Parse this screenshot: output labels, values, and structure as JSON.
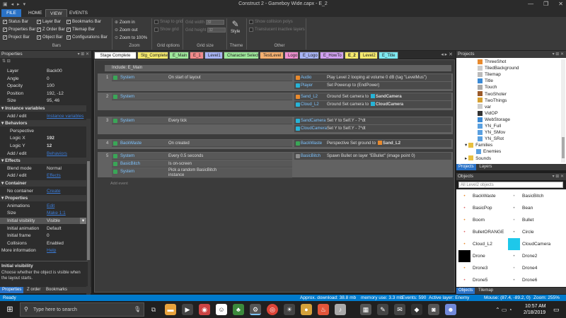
{
  "window": {
    "title": "Construct 2 - Gameboy Wide.capx - E_2",
    "quick_access": [
      "▣",
      "◂",
      "▸",
      "▾"
    ],
    "minimize": "—",
    "maximize": "❐",
    "close": "✕"
  },
  "ribbon": {
    "tabs": [
      "FILE",
      "HOME",
      "VIEW",
      "EVENTS"
    ],
    "bars": {
      "status": "Status Bar",
      "properties": "Properties Bar",
      "project": "Project Bar",
      "layer": "Layer Bar",
      "zorder": "Z Order Bar",
      "object": "Object Bar",
      "bookmarks": "Bookmarks Bar",
      "tilemap": "Tilemap Bar",
      "configurations": "Configurations Bar",
      "group": "Bars"
    },
    "zoom": {
      "in": "Zoom in",
      "out": "Zoom out",
      "reset": "Zoom to 100%",
      "group": "Zoom"
    },
    "grid_options": {
      "snap": "Snap to grid",
      "show": "Show grid",
      "group": "Grid options"
    },
    "grid_size": {
      "width_label": "Grid width",
      "width": "32",
      "height_label": "Grid height",
      "height": "32",
      "group": "Grid size"
    },
    "theme": {
      "style": "Style",
      "group": "Theme"
    },
    "other": {
      "collision": "Show collision polys",
      "translucent": "Translucent inactive layers",
      "group": "Other"
    }
  },
  "properties": {
    "title": "Properties",
    "rows": [
      {
        "k": "Layer",
        "v": "Back00",
        "t": "row"
      },
      {
        "k": "Angle",
        "v": "0",
        "t": "row"
      },
      {
        "k": "Opacity",
        "v": "100",
        "t": "row"
      },
      {
        "k": "Position",
        "v": "192, -12",
        "t": "row"
      },
      {
        "k": "Size",
        "v": "95, 46",
        "t": "row"
      },
      {
        "k": "Instance variables",
        "v": "",
        "t": "cat"
      },
      {
        "k": "Add / edit",
        "v": "Instance variables",
        "t": "link"
      },
      {
        "k": "Behaviors",
        "v": "",
        "t": "cat"
      },
      {
        "k": "Perspective",
        "v": "",
        "t": "sub"
      },
      {
        "k": "Logic X",
        "v": "192",
        "t": "subv"
      },
      {
        "k": "Logic Y",
        "v": "12",
        "t": "subv"
      },
      {
        "k": "Add / edit",
        "v": "Behaviors",
        "t": "link"
      },
      {
        "k": "Effects",
        "v": "",
        "t": "cat"
      },
      {
        "k": "Blend mode",
        "v": "Normal",
        "t": "row"
      },
      {
        "k": "Add / edit",
        "v": "Effects",
        "t": "link"
      },
      {
        "k": "Container",
        "v": "",
        "t": "cat"
      },
      {
        "k": "No container",
        "v": "Create",
        "t": "link"
      },
      {
        "k": "Properties",
        "v": "",
        "t": "cat"
      },
      {
        "k": "Animations",
        "v": "Edit",
        "t": "link"
      },
      {
        "k": "Size",
        "v": "Make 1:1",
        "t": "link"
      },
      {
        "k": "Initial visibility",
        "v": "Visible",
        "t": "sel"
      },
      {
        "k": "Initial animation",
        "v": "Default",
        "t": "row"
      },
      {
        "k": "Initial frame",
        "v": "0",
        "t": "row"
      },
      {
        "k": "Collisions",
        "v": "Enabled",
        "t": "row"
      },
      {
        "k": "More information",
        "v": "Help",
        "t": "linkroot"
      }
    ],
    "help_title": "Initial visibility",
    "help_text": "Choose whether the object is visible when the layout starts.",
    "bottom_tabs": [
      "Properties",
      "Z order",
      "Bookmarks"
    ]
  },
  "editor_tabs": [
    {
      "label": "Stage Complete",
      "color": "#ffffff"
    },
    {
      "label": "Stg_Complete",
      "color": "#f5e96e"
    },
    {
      "label": "E_Main",
      "color": "#9ee89b"
    },
    {
      "label": "E_1",
      "color": "#f08a8a"
    },
    {
      "label": "Level1",
      "color": "#a8b4f5"
    },
    {
      "label": "Character Select",
      "color": "#9ee89b"
    },
    {
      "label": "TestLevel",
      "color": "#f5b070"
    },
    {
      "label": "Logo",
      "color": "#f090d0"
    },
    {
      "label": "E_Logo",
      "color": "#a8b4f5"
    },
    {
      "label": "E_HowTo",
      "color": "#d0a0f0"
    },
    {
      "label": "E_2",
      "color": "#f5e96e"
    },
    {
      "label": "Level2",
      "color": "#f5e96e"
    },
    {
      "label": "E_Title",
      "color": "#7ee8f0"
    }
  ],
  "events": {
    "include": "Include: E_Main",
    "add_event": "Add event",
    "blocks": [
      {
        "num": "1",
        "conds": [
          {
            "obj": "System",
            "text": "On start of layout"
          }
        ],
        "acts": [
          {
            "obj": "Audio",
            "text": "Play Level 2 looping at volume 0 dB (tag \"LevelMus\")",
            "icon": "o"
          },
          {
            "obj": "Player",
            "text": "Set Powerup to (EndPower)",
            "icon": "c"
          }
        ]
      },
      {
        "num": "2",
        "conds": [
          {
            "obj": "System",
            "text": ""
          }
        ],
        "acts": [
          {
            "obj": "Sand_L2",
            "text": "Ground Set camera to",
            "target": "SandCamera",
            "icon": "o"
          },
          {
            "obj": "Cloud_L2",
            "text": "Ground Set camera to",
            "target": "CloudCamera",
            "icon": "c"
          }
        ]
      },
      {
        "num": "3",
        "conds": [
          {
            "obj": "System",
            "text": "Every tick"
          }
        ],
        "acts": [
          {
            "obj": "SandCamera",
            "text": "Set Y to Self.Y - 7*dt",
            "icon": "c"
          },
          {
            "obj": "CloudCamera",
            "text": "Set Y to Self.Y - 7*dt",
            "icon": "c"
          }
        ]
      },
      {
        "num": "4",
        "conds": [
          {
            "obj": "BackWaste",
            "text": "On created"
          }
        ],
        "acts": [
          {
            "obj": "BackWaste",
            "text": "Perspective Set ground to",
            "target": "Sand_L2",
            "icon": "g"
          }
        ]
      },
      {
        "num": "5",
        "conds": [
          {
            "obj": "System",
            "text": "Every 0.5 seconds"
          },
          {
            "obj": "BasicBitch",
            "text": "Is on-screen"
          },
          {
            "obj": "System",
            "text": "Pick a random BasicBitch instance"
          }
        ],
        "acts": [
          {
            "obj": "BasicBitch",
            "text": "Spawn Bullet on layer \"EBullet\" (image point 0)",
            "icon": "b"
          }
        ]
      }
    ]
  },
  "projects": {
    "title": "Projects",
    "items": [
      "ThreeShot",
      "TiledBackground",
      "Tilemap",
      "Title",
      "Touch",
      "TwoShoter",
      "TwoThings",
      "var",
      "VidOP",
      "WebStorage",
      "YN_Full",
      "YN_SMov",
      "YN_SRot",
      "Families",
      "Enemies",
      "Sounds"
    ],
    "bottom_tabs": [
      "Projects",
      "Layers"
    ]
  },
  "objects": {
    "title": "Objects",
    "filter": "All Level2 objects",
    "items": [
      "BackWaste",
      "BasicBitch",
      "BasicPop",
      "Bean",
      "Boom",
      "Bullet",
      "BulletORANGE",
      "Circle",
      "Cloud_L2",
      "CloudCamera",
      "Drone",
      "Drone2",
      "Drone3",
      "Drone4",
      "Drone5",
      "Drone6"
    ],
    "bottom_tabs": [
      "Objects",
      "Tilemap"
    ]
  },
  "status": {
    "left": "Ready",
    "download": "Approx. download: 38.8 mb",
    "memory": "memory use: 3.3 mb",
    "events": "Events: 590",
    "layer": "Active layer: Enemy",
    "mouse": "Mouse: (87.4, -89.2, 0)",
    "zoom": "Zoom: 255%"
  },
  "taskbar": {
    "search": "Type here to search",
    "time": "10:57 AM",
    "date": "2/18/2019"
  }
}
